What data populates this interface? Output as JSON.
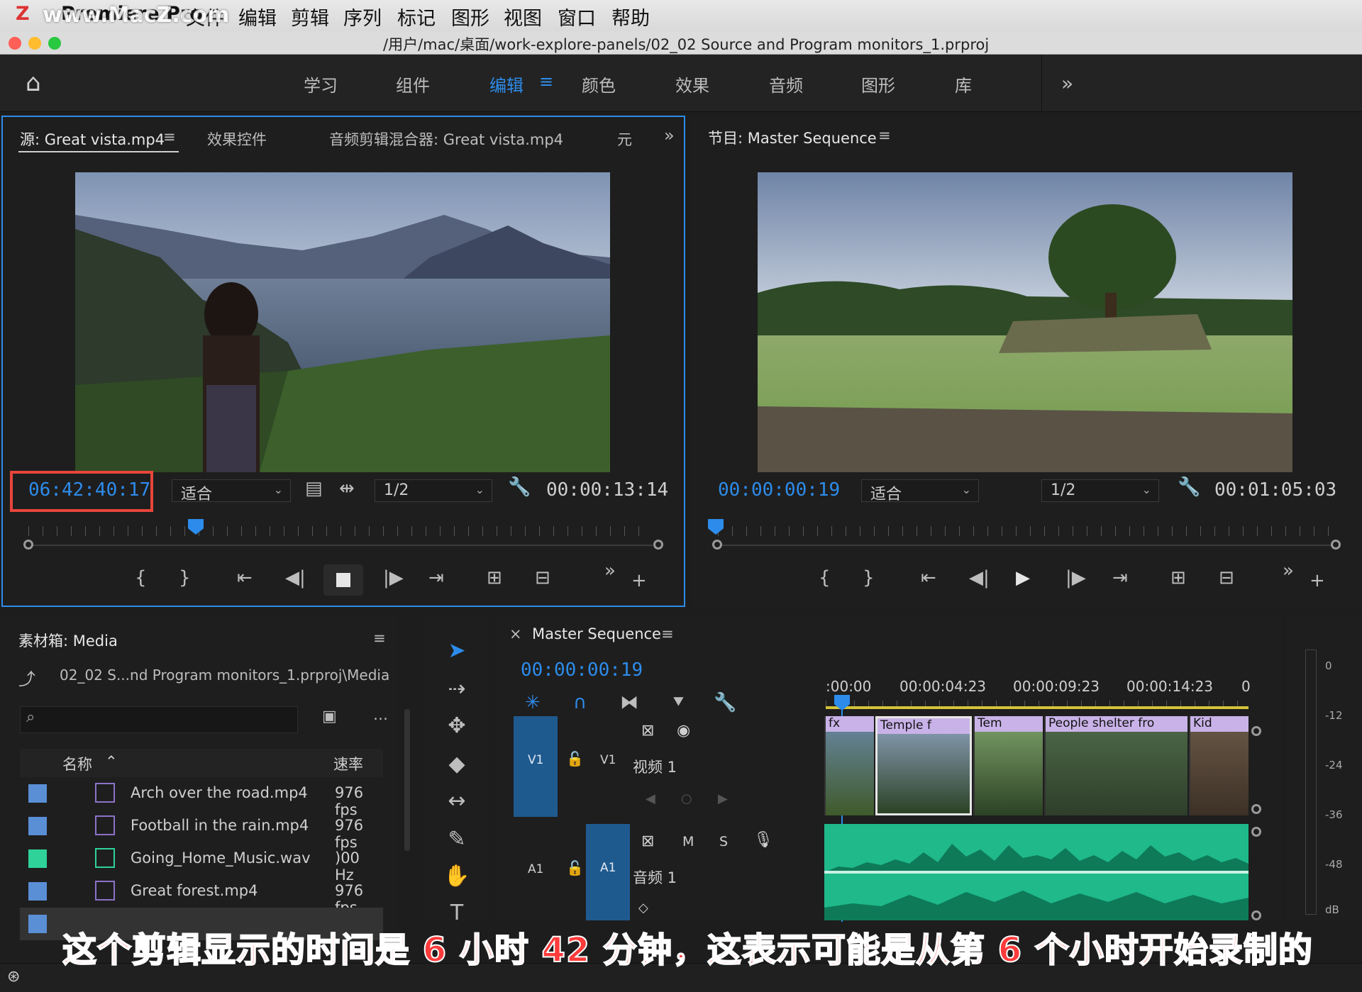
{
  "menubar": {
    "watermark": "www.MacZ.com",
    "app": "Premiere Pro",
    "items": [
      "文件",
      "编辑",
      "剪辑",
      "序列",
      "标记",
      "图形",
      "视图",
      "窗口",
      "帮助"
    ]
  },
  "window_title": "/用户/mac/桌面/work-explore-panels/02_02 Source and Program monitors_1.prproj",
  "workspaces": {
    "items": [
      "学习",
      "组件",
      "编辑",
      "颜色",
      "效果",
      "音频",
      "图形",
      "库"
    ],
    "active": "编辑",
    "more": "»"
  },
  "source": {
    "tab_active": "源: Great vista.mp4",
    "tab2": "效果控件",
    "tab3": "音频剪辑混合器: Great vista.mp4",
    "tab4": "元",
    "timecode": "06:42:40:17",
    "fit": "适合",
    "resolution": "1/2",
    "duration": "00:00:13:14"
  },
  "program": {
    "tab": "节目: Master Sequence",
    "timecode": "00:00:00:19",
    "fit": "适合",
    "resolution": "1/2",
    "duration": "00:01:05:03"
  },
  "bin": {
    "title": "素材箱: Media",
    "path": "02_02 S...nd Program monitors_1.prproj\\Media",
    "col_name": "名称",
    "col_rate": "速率",
    "rows": [
      {
        "name": "Arch over the road.mp4",
        "rate": "976 fps",
        "color": "#5a8fd6"
      },
      {
        "name": "Football in the rain.mp4",
        "rate": "976 fps",
        "color": "#5a8fd6"
      },
      {
        "name": "Going_Home_Music.wav",
        "rate": ")00 Hz",
        "color": "#2fd39a"
      },
      {
        "name": "Great forest.mp4",
        "rate": "976 fps",
        "color": "#5a8fd6"
      }
    ]
  },
  "timeline": {
    "title": "Master Sequence",
    "timecode": "00:00:00:19",
    "ruler": [
      ":00:00",
      "00:00:04:23",
      "00:00:09:23",
      "00:00:14:23",
      "0"
    ],
    "v1_left": "V1",
    "v1_right": "V1",
    "video_track": "视频 1",
    "a1_left": "A1",
    "a1_right": "A1",
    "audio_track": "音频 1",
    "m": "M",
    "s": "S",
    "clips": [
      "Temple f",
      "Tem",
      "People shelter fro",
      "Kid"
    ]
  },
  "meter": {
    "labels": [
      "0",
      "-12",
      "-24",
      "-36",
      "-48",
      "dB"
    ]
  },
  "caption": "这个剪辑显示的时间是 6 小时 42 分钟，这表示可能是从第 6 个小时开始录制的"
}
